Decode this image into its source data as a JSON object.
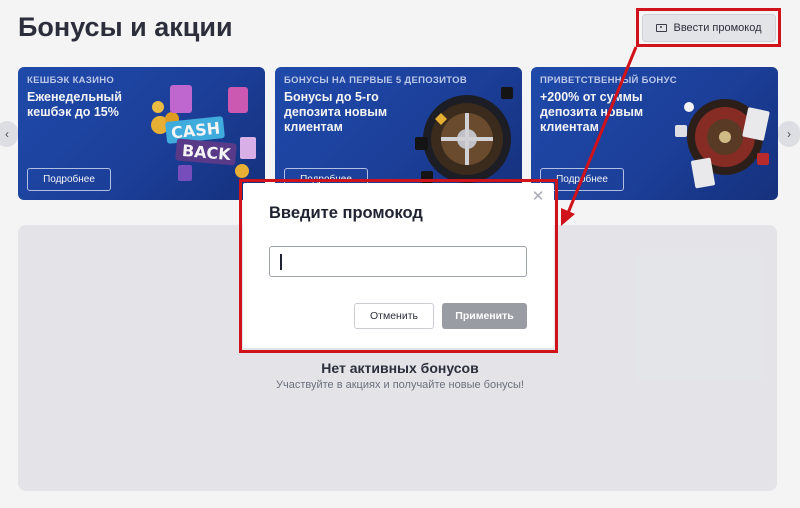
{
  "page": {
    "title": "Бонусы и акции",
    "promo_button_label": "Ввести промокод"
  },
  "slider": {
    "prev_icon": "chevron-left-icon",
    "next_icon": "chevron-right-icon",
    "cards": [
      {
        "tag": "КЕШБЭК КАЗИНО",
        "heading": "Еженедельный кешбэк до 15%",
        "button": "Подробнее",
        "art_text": [
          "CASH",
          "BACK"
        ]
      },
      {
        "tag": "БОНУСЫ НА ПЕРВЫЕ 5 ДЕПОЗИТОВ",
        "heading": "Бонусы до 5-го депозита новым клиентам",
        "button": "Подробнее"
      },
      {
        "tag": "ПРИВЕТСТВЕННЫЙ БОНУС",
        "heading": "+200% от суммы депозита новым клиентам",
        "button": "Подробнее"
      }
    ]
  },
  "empty_state": {
    "title": "Нет активных бонусов",
    "subtitle": "Участвуйте в акциях и получайте новые бонусы!"
  },
  "modal": {
    "title": "Введите промокод",
    "input_value": "",
    "cancel_label": "Отменить",
    "apply_label": "Применить",
    "close_icon": "close-icon"
  },
  "colors": {
    "highlight": "#d0121b",
    "card_blue": "#1d4bb0",
    "apply_disabled": "#9a9ca3"
  }
}
